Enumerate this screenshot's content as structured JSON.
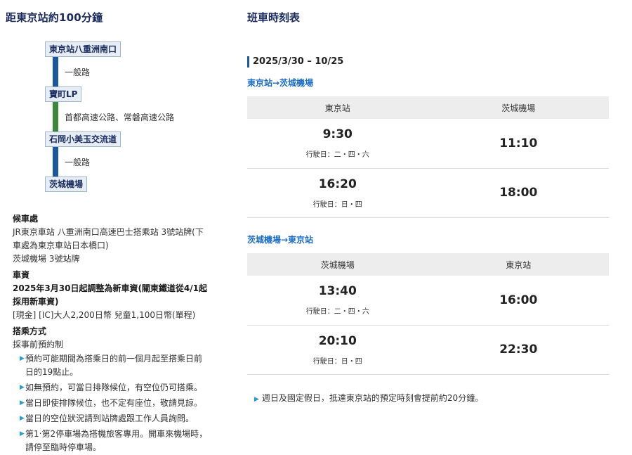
{
  "left": {
    "title": "距東京站約100分鐘",
    "route": {
      "stops": [
        "東京站八重洲南口",
        "寶町LP",
        "石岡小美玉交流道",
        "茨城機場"
      ],
      "segments": [
        {
          "label": "一般路",
          "color": "#1a5a9c"
        },
        {
          "label": "首都高速公路、常磐高速公路",
          "color": "#3a8a3a"
        },
        {
          "label": "一般路",
          "color": "#1a5a9c"
        }
      ]
    },
    "info": {
      "waiting_head": "候車處",
      "waiting_lines": [
        "JR東京車站 八重洲南口高速巴士搭乘站 3號站牌(下車處為東京車站日本橋口)",
        "茨城機場 3號站牌"
      ],
      "fare_head": "車資",
      "fare_bold": "2025年3月30日起調整為新車資(關東鐵道從4/1起採用新車資)",
      "fare_line": "[現金] [IC]大人2,200日幣 兒童1,100日幣(單程)",
      "boarding_head": "搭乘方式",
      "boarding_line": "採事前預約制",
      "bullets": [
        "預約可能期間為搭乘日的前一個月起至搭乘日前日的19點止。",
        "如無預約，可當日排隊候位，有空位仍可搭乘。",
        "當日即使排隊候位，也不定有座位，敬請見諒。",
        "當日的空位狀況請到站牌處跟工作人員詢問。",
        "第1‧第2停車場為搭機旅客專用。開車來機場時，請停至臨時停車場。"
      ]
    }
  },
  "right": {
    "title": "班車時刻表",
    "period": "2025/3/30 – 10/25",
    "tables": [
      {
        "direction": "東京站→茨城機場",
        "headers": [
          "東京站",
          "茨城機場"
        ],
        "rows": [
          {
            "dep": "9:30",
            "days": "行駛日：二・四・六",
            "arr": "11:10"
          },
          {
            "dep": "16:20",
            "days": "行駛日：日・四",
            "arr": "18:00"
          }
        ]
      },
      {
        "direction": "茨城機場→東京站",
        "headers": [
          "茨城機場",
          "東京站"
        ],
        "rows": [
          {
            "dep": "13:40",
            "days": "行駛日：二・四・六",
            "arr": "16:00"
          },
          {
            "dep": "20:10",
            "days": "行駛日：日・四",
            "arr": "22:30"
          }
        ]
      }
    ],
    "note": "週日及國定假日，抵達東京站的預定時刻會提前約20分鐘。"
  }
}
